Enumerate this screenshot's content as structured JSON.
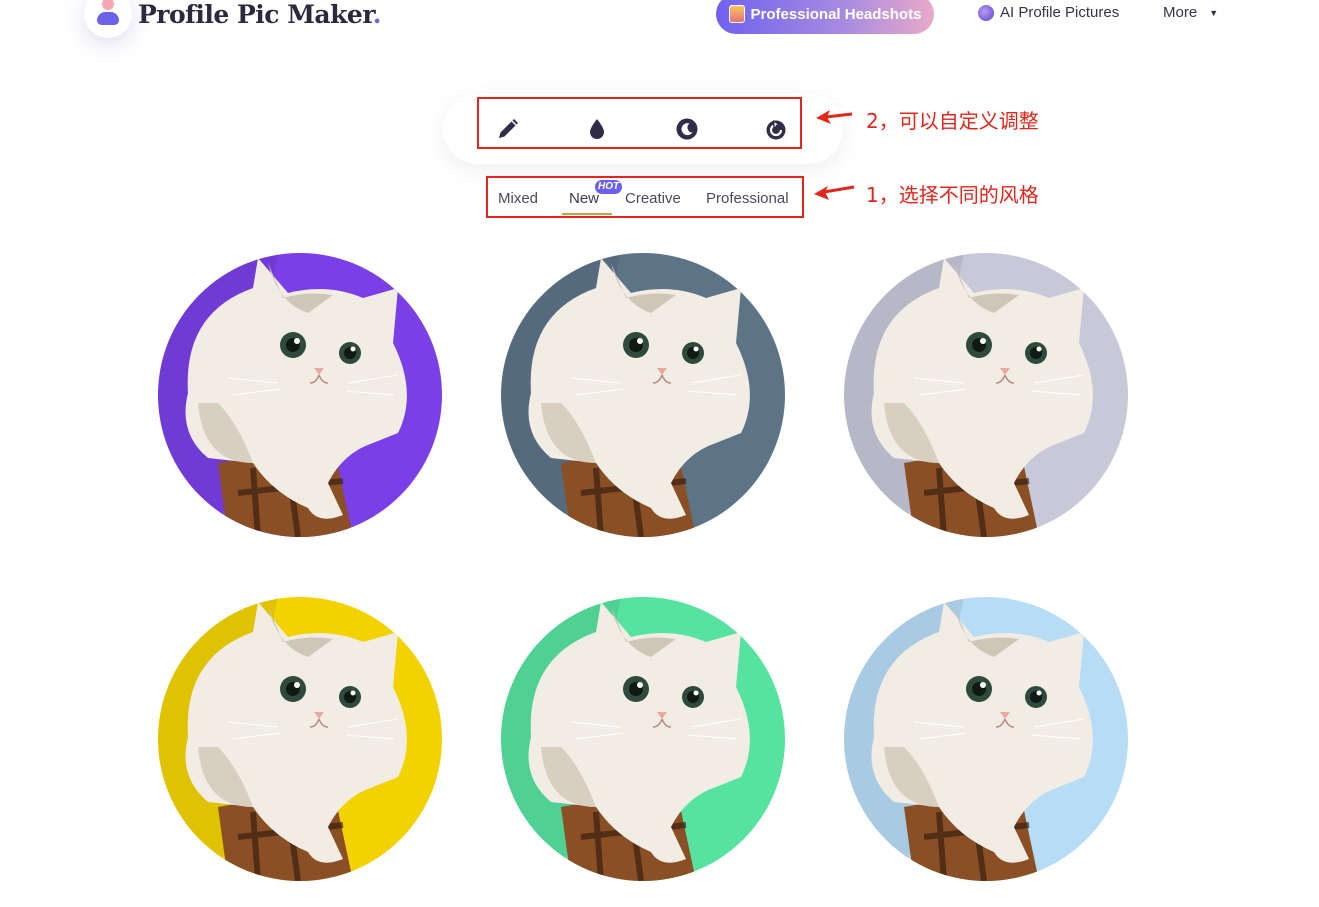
{
  "header": {
    "brand_name": "Profile Pic Maker",
    "brand_dot": ".",
    "nav": [
      {
        "label": "Professional Headshots"
      },
      {
        "label": "AI Profile Pictures"
      },
      {
        "label": "More"
      }
    ]
  },
  "toolbar": {
    "tools": [
      "edit-icon",
      "color-drop-icon",
      "shadow-icon",
      "reset-icon"
    ]
  },
  "tabs": {
    "items": [
      {
        "label": "Mixed"
      },
      {
        "label": "New",
        "badge": "HOT",
        "active": true
      },
      {
        "label": "Creative"
      },
      {
        "label": "Professional"
      }
    ]
  },
  "annotations": [
    {
      "text": "2，可以自定义调整"
    },
    {
      "text": "1，选择不同的风格"
    }
  ],
  "colors": {
    "accent": "#6b63e8",
    "annotation": "#e3261b",
    "avatar_backgrounds": [
      "#7a3fe6",
      "#5d7487",
      "#c7c8d8",
      "#f2d300",
      "#56e3a0",
      "#b7dcf6"
    ]
  }
}
